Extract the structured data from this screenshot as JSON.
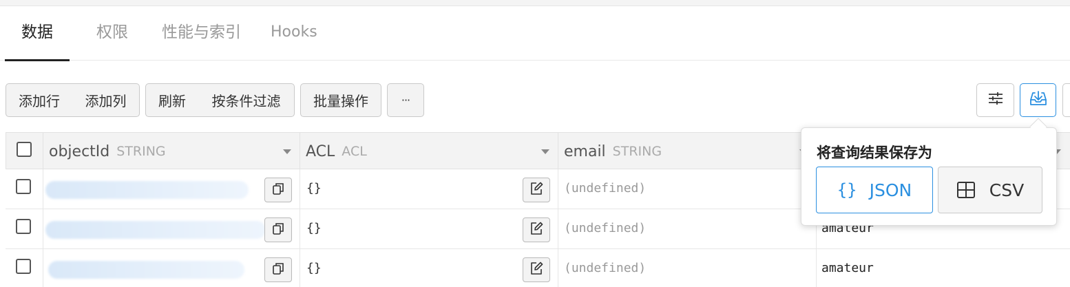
{
  "tabs": [
    {
      "label": "数据",
      "active": true
    },
    {
      "label": "权限",
      "active": false
    },
    {
      "label": "性能与索引",
      "active": false
    },
    {
      "label": "Hooks",
      "active": false
    }
  ],
  "toolbar": {
    "add_row": "添加行",
    "add_column": "添加列",
    "refresh": "刷新",
    "filter": "按条件过滤",
    "batch": "批量操作",
    "more": "···"
  },
  "icons": {
    "more": "ellipsis-icon",
    "settings": "sliders-icon",
    "export": "download-icon"
  },
  "columns": [
    {
      "name": "objectId",
      "type": "STRING"
    },
    {
      "name": "ACL",
      "type": "ACL"
    },
    {
      "name": "email",
      "type": "STRING"
    }
  ],
  "rows": [
    {
      "acl": "{}",
      "email": "(undefined)",
      "extra": ""
    },
    {
      "acl": "{}",
      "email": "(undefined)",
      "extra": "amateur"
    },
    {
      "acl": "{}",
      "email": "(undefined)",
      "extra": "amateur"
    }
  ],
  "export_popover": {
    "title": "将查询结果保存为",
    "json_braces": "{}",
    "json_label": "JSON",
    "csv_label": "CSV"
  },
  "colors": {
    "accent": "#2a8fe0",
    "text": "#333333",
    "muted": "#999999"
  }
}
